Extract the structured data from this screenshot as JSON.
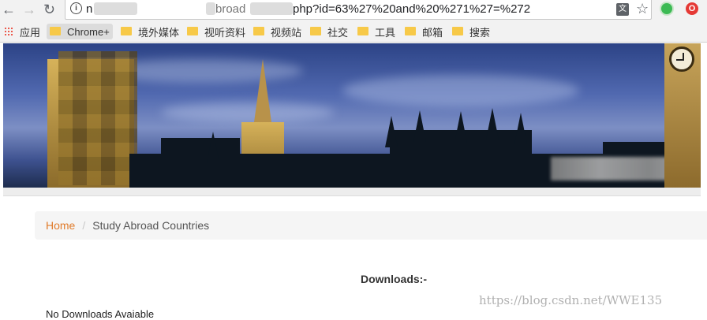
{
  "browser": {
    "url_visible_start": "n",
    "url_visible_mid": "broad",
    "url_visible_end": "php?id=63%27%20and%20%271%27=%272",
    "info_icon": "i"
  },
  "bookmarks": [
    {
      "label": "应用",
      "icon": "apps-grid-icon"
    },
    {
      "label": "Chrome+",
      "icon": "folder-icon"
    },
    {
      "label": "境外媒体",
      "icon": "folder-icon"
    },
    {
      "label": "视听资料",
      "icon": "folder-icon"
    },
    {
      "label": "视频站",
      "icon": "folder-icon"
    },
    {
      "label": "社交",
      "icon": "folder-icon"
    },
    {
      "label": "工具",
      "icon": "folder-icon"
    },
    {
      "label": "邮箱",
      "icon": "folder-icon"
    },
    {
      "label": "搜索",
      "icon": "folder-icon"
    }
  ],
  "breadcrumb": {
    "home": "Home",
    "separator": "/",
    "current": "Study Abroad Countries"
  },
  "content": {
    "downloads_title": "Downloads:-",
    "no_downloads": "No Downloads Avaiable"
  },
  "watermark": "https://blog.csdn.net/WWE135",
  "colors": {
    "home_link": "#e07b2a",
    "breadcrumb_bg": "#f5f5f5",
    "chrome_bg": "#f2f2f2",
    "folder": "#f7c948"
  }
}
